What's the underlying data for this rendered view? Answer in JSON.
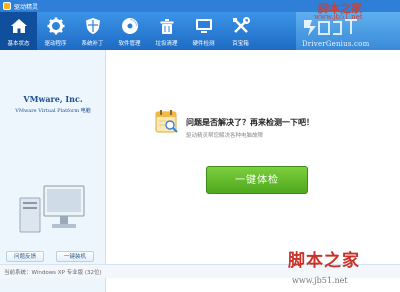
{
  "window": {
    "title": "驱动精灵"
  },
  "toolbar": {
    "items": [
      {
        "label": "基本状态",
        "icon": "home-icon",
        "active": true
      },
      {
        "label": "驱动程序",
        "icon": "gear-icon"
      },
      {
        "label": "系统补丁",
        "icon": "shield-icon"
      },
      {
        "label": "软件管理",
        "icon": "disc-icon"
      },
      {
        "label": "垃圾清理",
        "icon": "cleanup-icon"
      },
      {
        "label": "硬件检测",
        "icon": "monitor-icon"
      },
      {
        "label": "百宝箱",
        "icon": "tools-icon"
      }
    ]
  },
  "brand": {
    "url": "DriverGenius.com"
  },
  "left": {
    "product": "VMware, Inc.",
    "platform": "VMware Virtual Platform 电脑",
    "feedback_label": "问题反馈",
    "install_label": "一键装机"
  },
  "main": {
    "question": "问题是否解决了？再来检测一下吧！",
    "hint": "驱动精灵帮您解决各种电脑故障",
    "check_label": "一键体检"
  },
  "status": {
    "text": "当前系统：Windows XP 专业版 (32位)"
  },
  "watermark": {
    "top": "脚本之家",
    "top_url": "www.jb51.net",
    "bottom": "脚本之家",
    "bottom_url": "www.jb51.net"
  },
  "colors": {
    "toolbar": "#2f7ed8",
    "check_button": "#5fb92a",
    "watermark": "#c8322a"
  }
}
